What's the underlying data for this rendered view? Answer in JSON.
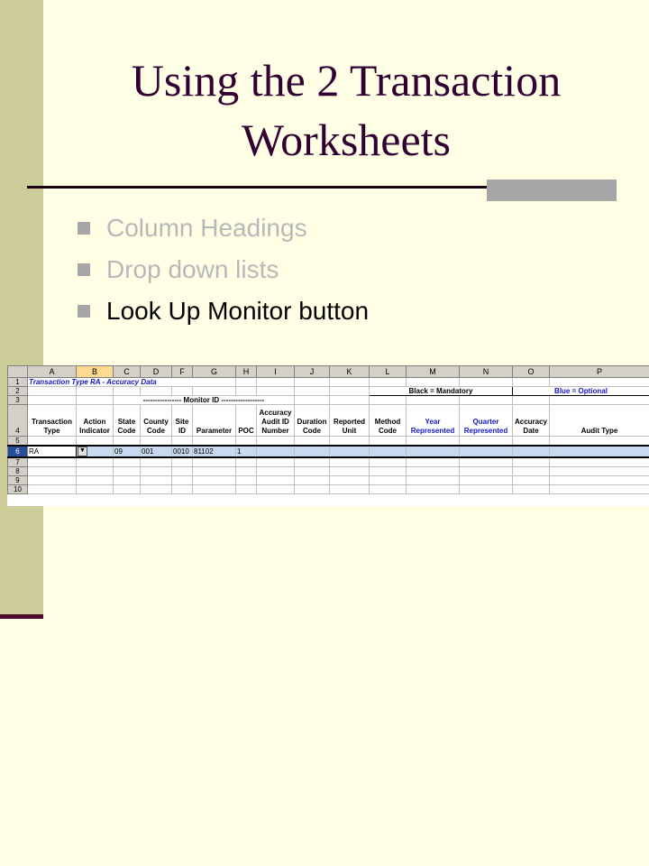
{
  "slide": {
    "title_line1": "Using the 2 Transaction",
    "title_line2": "Worksheets",
    "bullets": [
      {
        "text": "Column Headings",
        "state": "dim"
      },
      {
        "text": "Drop down lists",
        "state": "dim"
      },
      {
        "text": "Look Up Monitor button",
        "state": "active"
      }
    ]
  },
  "sheet": {
    "columns": [
      "A",
      "B",
      "C",
      "D",
      "F",
      "G",
      "H",
      "I",
      "J",
      "K",
      "L",
      "M",
      "N",
      "O",
      "P"
    ],
    "row_numbers": [
      "1",
      "2",
      "3",
      "4",
      "5",
      "6",
      "7",
      "8",
      "9",
      "10"
    ],
    "row1_title": "Transaction Type RA  -  Accuracy Data",
    "legend_black": "Black = Mandatory",
    "legend_blue": "Blue = Optional",
    "monitor_id_label": "---------------- Monitor ID ------------------",
    "headers": [
      "Transaction Type",
      "Action Indicator",
      "State Code",
      "County Code",
      "Site ID",
      "Parameter",
      "POC",
      "Accuracy Audit ID Number",
      "Duration Code",
      "Reported Unit",
      "Method Code",
      "Year Represented",
      "Quarter Represented",
      "Accuracy Date",
      "Audit Type"
    ],
    "row6": {
      "transaction_type": "RA",
      "dropdown_icon": "chevron-down-icon",
      "state_code": "09",
      "county_code": "001",
      "site_id": "0010",
      "parameter": "81102",
      "poc": "1"
    }
  },
  "colors": {
    "background": "#FFFFE5",
    "side_band": "#CCCC99",
    "title": "#330033",
    "optional_blue": "#1515C8"
  }
}
